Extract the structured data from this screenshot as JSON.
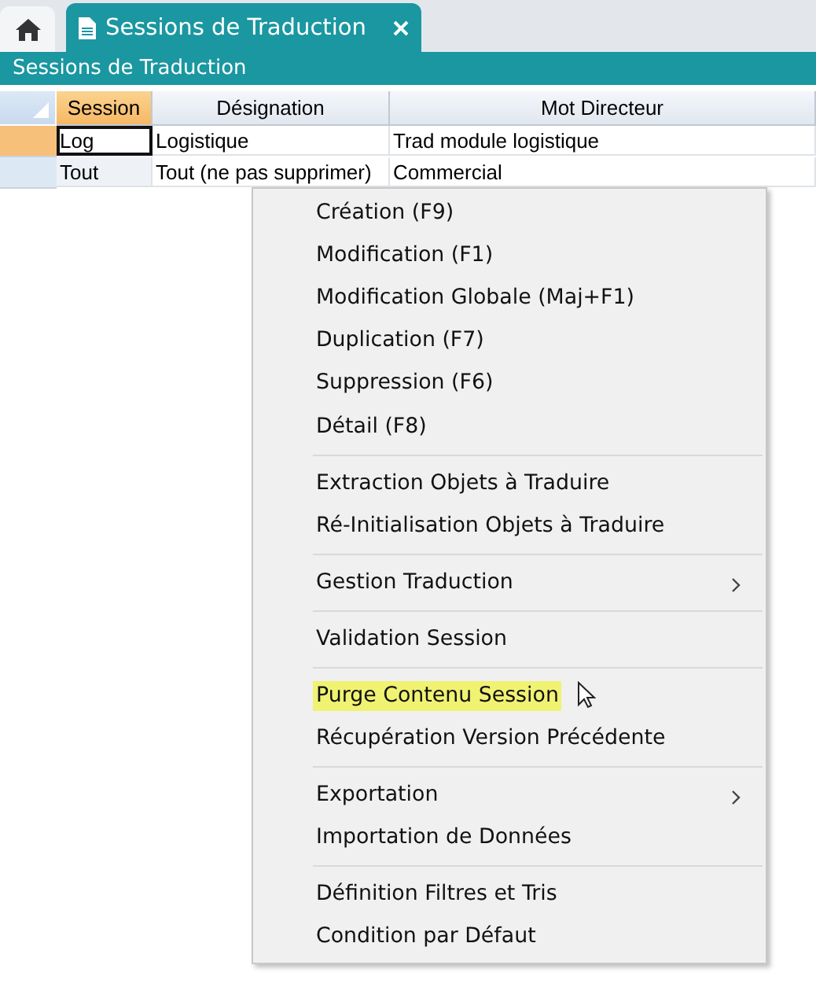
{
  "tabs": [
    {
      "kind": "home",
      "selected": false
    },
    {
      "kind": "document",
      "label": "Sessions de Traduction",
      "selected": true,
      "closable": true
    }
  ],
  "title_bar": {
    "title": "Sessions de Traduction"
  },
  "table": {
    "columns": [
      {
        "label": "Session",
        "selected": true
      },
      {
        "label": "Désignation",
        "selected": false
      },
      {
        "label": "Mot Directeur",
        "selected": false
      }
    ],
    "rows": [
      {
        "selected": true,
        "cells": [
          "Log",
          "Logistique",
          "Trad module logistique"
        ]
      },
      {
        "selected": false,
        "cells": [
          "Tout",
          "Tout (ne pas supprimer)",
          "Commercial"
        ]
      }
    ]
  },
  "context_menu": {
    "groups": [
      [
        {
          "label": "Création (F9)",
          "highlighted": false,
          "submenu": false
        },
        {
          "label": "Modification (F1)",
          "highlighted": false,
          "submenu": false
        },
        {
          "label": "Modification Globale (Maj+F1)",
          "highlighted": false,
          "submenu": false
        },
        {
          "label": "Duplication (F7)",
          "highlighted": false,
          "submenu": false
        },
        {
          "label": "Suppression (F6)",
          "highlighted": false,
          "submenu": false
        },
        {
          "label": "Détail (F8)",
          "highlighted": false,
          "submenu": false
        }
      ],
      [
        {
          "label": "Extraction Objets à Traduire",
          "highlighted": false,
          "submenu": false
        },
        {
          "label": "Ré-Initialisation Objets à Traduire",
          "highlighted": false,
          "submenu": false
        }
      ],
      [
        {
          "label": "Gestion Traduction",
          "highlighted": false,
          "submenu": true
        }
      ],
      [
        {
          "label": "Validation Session",
          "highlighted": false,
          "submenu": false
        }
      ],
      [
        {
          "label": "Purge Contenu Session",
          "highlighted": true,
          "submenu": false,
          "pointer": true
        },
        {
          "label": "Récupération Version Précédente",
          "highlighted": false,
          "submenu": false
        }
      ],
      [
        {
          "label": "Exportation",
          "highlighted": false,
          "submenu": true
        },
        {
          "label": "Importation de Données",
          "highlighted": false,
          "submenu": false
        }
      ],
      [
        {
          "label": "Définition Filtres et Tris",
          "highlighted": false,
          "submenu": false
        },
        {
          "label": "Condition par Défaut",
          "highlighted": false,
          "submenu": false
        }
      ]
    ]
  }
}
